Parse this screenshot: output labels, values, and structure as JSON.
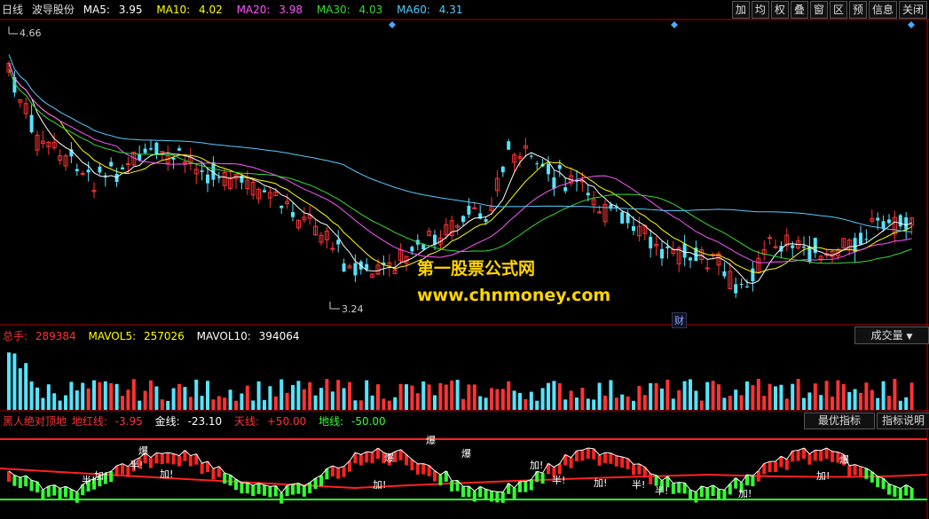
{
  "colors": {
    "ma5": "#ffffff",
    "ma10": "#ffff00",
    "ma20": "#ff55ff",
    "ma30": "#33dd33",
    "ma60": "#55ccff",
    "up": "#ff3333",
    "down": "#55e4ff",
    "red": "#ff2222",
    "green": "#33ff33"
  },
  "toolbar": {
    "period": "日线",
    "stock": "波导股份",
    "ma5_label": "MA5:",
    "ma5_value": "3.95",
    "ma10_label": "MA10:",
    "ma10_value": "4.02",
    "ma20_label": "MA20:",
    "ma20_value": "3.98",
    "ma30_label": "MA30:",
    "ma30_value": "4.03",
    "ma60_label": "MA60:",
    "ma60_value": "4.31",
    "buttons": [
      "加",
      "均",
      "权",
      "叠",
      "窗",
      "区",
      "预",
      "信息",
      "关闭"
    ]
  },
  "price": {
    "high_label": "4.66",
    "low_label": "3.24",
    "event_marker": "财"
  },
  "watermark": {
    "line1": "第一股票公式网",
    "line2": "www.chnmoney.com"
  },
  "volume": {
    "total_label": "总手:",
    "total_value": "289384",
    "mavol5_label": "MAVOL5:",
    "mavol5_value": "257026",
    "mavol10_label": "MAVOL10:",
    "mavol10_value": "394064",
    "selector": "成交量"
  },
  "indicator": {
    "name": "黑人绝对顶地",
    "dihong_label": "地红线:",
    "dihong_value": "-3.95",
    "jin_label": "金线:",
    "jin_value": "-23.10",
    "tian_label": "天线:",
    "tian_value": "+50.00",
    "di_label": "地线:",
    "di_value": "-50.00",
    "best_button": "最优指标",
    "help_button": "指标说明",
    "annotations": [
      "半!",
      "加!",
      "爆",
      "半!",
      "加!",
      "加!",
      "爆",
      "爆",
      "爆",
      "加!",
      "半!",
      "加!",
      "半!",
      "半!",
      "加!",
      "爆",
      "加!"
    ]
  }
}
